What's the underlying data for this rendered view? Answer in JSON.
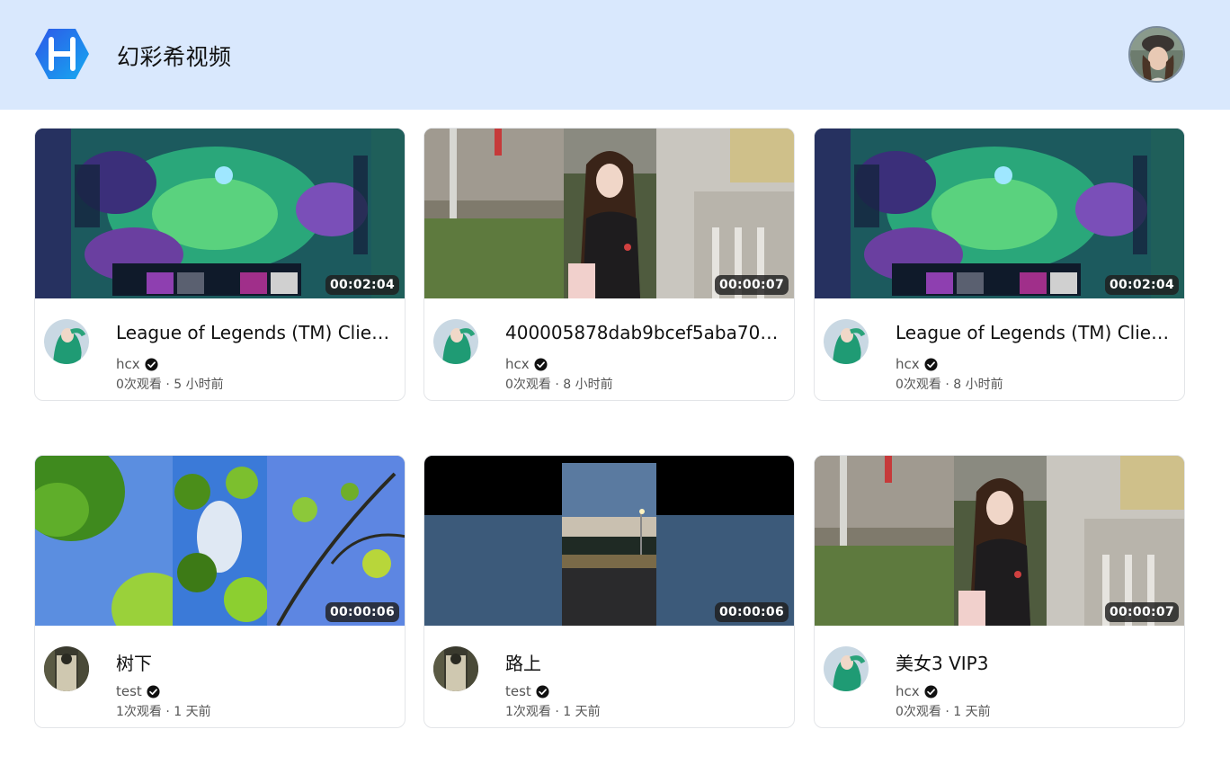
{
  "header": {
    "site_title": "幻彩希视频",
    "logo_icon": "h-hexagon-logo-icon",
    "user_avatar": "user-avatar-photo"
  },
  "colors": {
    "header_bg": "#d9e8fd",
    "logo_gradient_start": "#2e6bf0",
    "logo_gradient_end": "#1aa6ef"
  },
  "videos": [
    {
      "title": "League of Legends (TM) Client...",
      "channel": "hcx",
      "stats": "0次观看 · 5 小时前",
      "duration": "00:02:04",
      "thumb": "game"
    },
    {
      "title": "400005878dab9bcef5aba7069...",
      "channel": "hcx",
      "stats": "0次观看 · 8 小时前",
      "duration": "00:00:07",
      "thumb": "girl"
    },
    {
      "title": "League of Legends (TM) Client...",
      "channel": "hcx",
      "stats": "0次观看 · 8 小时前",
      "duration": "00:02:04",
      "thumb": "game"
    },
    {
      "title": "树下",
      "channel": "test",
      "stats": "1次观看 · 1 天前",
      "duration": "00:00:06",
      "thumb": "trees"
    },
    {
      "title": "路上",
      "channel": "test",
      "stats": "1次观看 · 1 天前",
      "duration": "00:00:06",
      "thumb": "road"
    },
    {
      "title": "美女3 VIP3",
      "channel": "hcx",
      "stats": "0次观看 · 1 天前",
      "duration": "00:00:07",
      "thumb": "girl"
    }
  ]
}
